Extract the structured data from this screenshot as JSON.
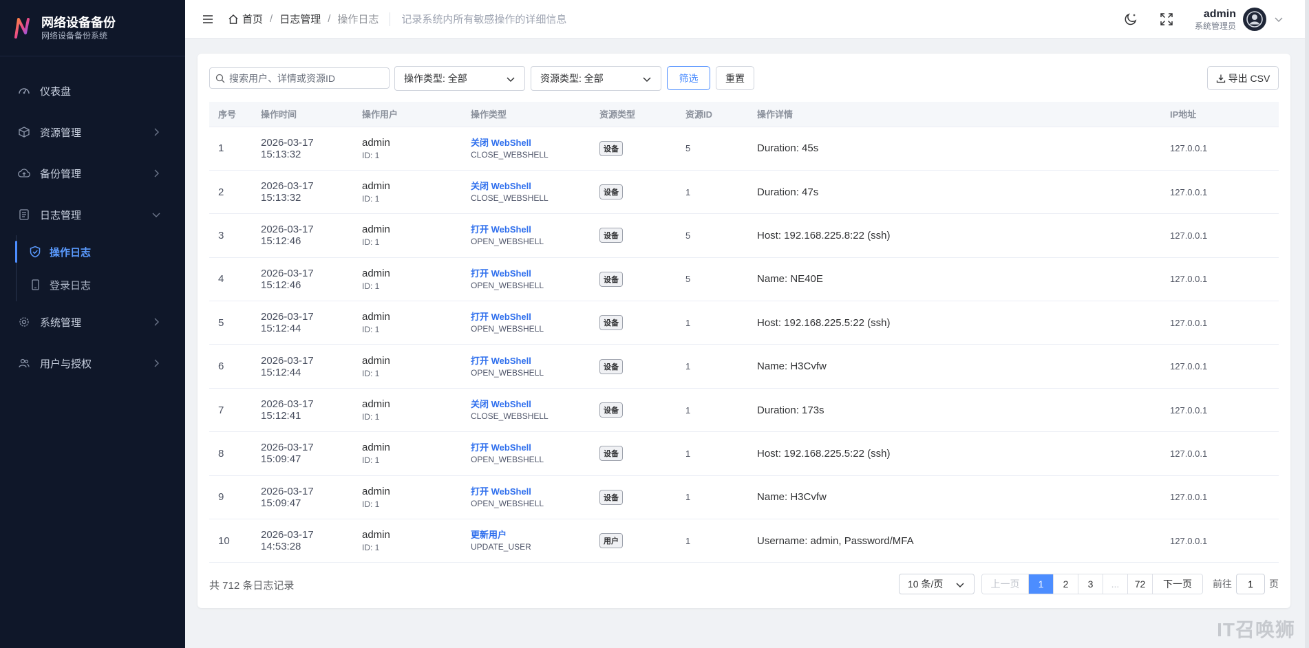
{
  "brand": {
    "title": "网络设备备份",
    "subtitle": "网络设备备份系统"
  },
  "sidebar": {
    "items": [
      {
        "label": "仪表盘"
      },
      {
        "label": "资源管理"
      },
      {
        "label": "备份管理"
      },
      {
        "label": "日志管理"
      },
      {
        "label": "系统管理"
      },
      {
        "label": "用户与授权"
      }
    ],
    "sub_items": [
      {
        "label": "操作日志"
      },
      {
        "label": "登录日志"
      }
    ]
  },
  "header": {
    "breadcrumb": [
      "首页",
      "日志管理",
      "操作日志"
    ],
    "description": "记录系统内所有敏感操作的详细信息",
    "user_name": "admin",
    "user_role": "系统管理员"
  },
  "toolbar": {
    "search_placeholder": "搜索用户、详情或资源ID",
    "op_type_select": "操作类型: 全部",
    "res_type_select": "资源类型: 全部",
    "filter_label": "筛选",
    "reset_label": "重置",
    "export_label": "导出 CSV"
  },
  "table": {
    "headers": [
      "序号",
      "操作时间",
      "操作用户",
      "操作类型",
      "资源类型",
      "资源ID",
      "操作详情",
      "IP地址"
    ],
    "rows": [
      {
        "num": "1",
        "time": "2026-03-17 15:13:32",
        "user": "admin",
        "user_id": "ID: 1",
        "op": "关闭 WebShell",
        "op_code": "CLOSE_WEBSHELL",
        "res_type": "设备",
        "res_id": "5",
        "detail": "Duration: 45s",
        "ip": "127.0.0.1"
      },
      {
        "num": "2",
        "time": "2026-03-17 15:13:32",
        "user": "admin",
        "user_id": "ID: 1",
        "op": "关闭 WebShell",
        "op_code": "CLOSE_WEBSHELL",
        "res_type": "设备",
        "res_id": "1",
        "detail": "Duration: 47s",
        "ip": "127.0.0.1"
      },
      {
        "num": "3",
        "time": "2026-03-17 15:12:46",
        "user": "admin",
        "user_id": "ID: 1",
        "op": "打开 WebShell",
        "op_code": "OPEN_WEBSHELL",
        "res_type": "设备",
        "res_id": "5",
        "detail": "Host: 192.168.225.8:22 (ssh)",
        "ip": "127.0.0.1"
      },
      {
        "num": "4",
        "time": "2026-03-17 15:12:46",
        "user": "admin",
        "user_id": "ID: 1",
        "op": "打开 WebShell",
        "op_code": "OPEN_WEBSHELL",
        "res_type": "设备",
        "res_id": "5",
        "detail": "Name: NE40E",
        "ip": "127.0.0.1"
      },
      {
        "num": "5",
        "time": "2026-03-17 15:12:44",
        "user": "admin",
        "user_id": "ID: 1",
        "op": "打开 WebShell",
        "op_code": "OPEN_WEBSHELL",
        "res_type": "设备",
        "res_id": "1",
        "detail": "Host: 192.168.225.5:22 (ssh)",
        "ip": "127.0.0.1"
      },
      {
        "num": "6",
        "time": "2026-03-17 15:12:44",
        "user": "admin",
        "user_id": "ID: 1",
        "op": "打开 WebShell",
        "op_code": "OPEN_WEBSHELL",
        "res_type": "设备",
        "res_id": "1",
        "detail": "Name: H3Cvfw",
        "ip": "127.0.0.1"
      },
      {
        "num": "7",
        "time": "2026-03-17 15:12:41",
        "user": "admin",
        "user_id": "ID: 1",
        "op": "关闭 WebShell",
        "op_code": "CLOSE_WEBSHELL",
        "res_type": "设备",
        "res_id": "1",
        "detail": "Duration: 173s",
        "ip": "127.0.0.1"
      },
      {
        "num": "8",
        "time": "2026-03-17 15:09:47",
        "user": "admin",
        "user_id": "ID: 1",
        "op": "打开 WebShell",
        "op_code": "OPEN_WEBSHELL",
        "res_type": "设备",
        "res_id": "1",
        "detail": "Host: 192.168.225.5:22 (ssh)",
        "ip": "127.0.0.1"
      },
      {
        "num": "9",
        "time": "2026-03-17 15:09:47",
        "user": "admin",
        "user_id": "ID: 1",
        "op": "打开 WebShell",
        "op_code": "OPEN_WEBSHELL",
        "res_type": "设备",
        "res_id": "1",
        "detail": "Name: H3Cvfw",
        "ip": "127.0.0.1"
      },
      {
        "num": "10",
        "time": "2026-03-17 14:53:28",
        "user": "admin",
        "user_id": "ID: 1",
        "op": "更新用户",
        "op_code": "UPDATE_USER",
        "res_type": "用户",
        "res_id": "1",
        "detail": "Username: admin, Password/MFA",
        "ip": "127.0.0.1"
      }
    ]
  },
  "footer": {
    "total": "共 712 条日志记录",
    "page_size": "10 条/页",
    "prev": "上一页",
    "pages": [
      "1",
      "2",
      "3",
      "...",
      "72"
    ],
    "next": "下一页",
    "goto_prefix": "前往",
    "goto_value": "1",
    "goto_suffix": "页"
  },
  "watermark": "IT召唤狮",
  "colors": {
    "accent": "#4c8dff",
    "sidebar_bg": "#0f1729",
    "link": "#2f6fed"
  },
  "icons": {
    "sidebar": [
      "dashboard-icon",
      "cube-icon",
      "cloud-upload-icon",
      "document-icon",
      "cog-icon",
      "users-icon"
    ],
    "sub": [
      "shield-icon",
      "phone-icon"
    ]
  }
}
